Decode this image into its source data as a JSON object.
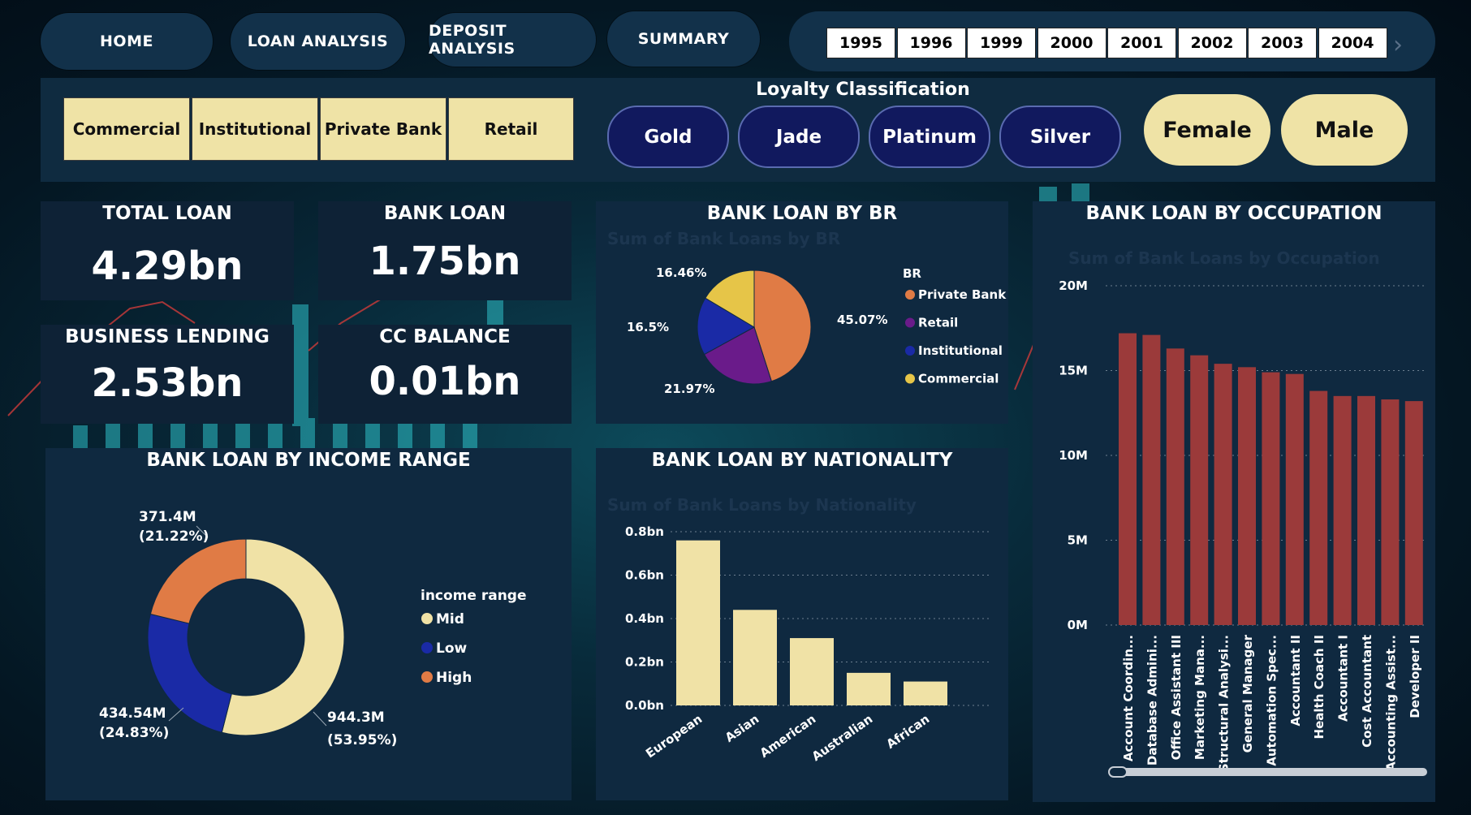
{
  "nav": {
    "home": "HOME",
    "loan_analysis": "LOAN ANALYSIS",
    "deposit_analysis": "DEPOSIT ANALYSIS",
    "summary": "SUMMARY"
  },
  "years": [
    "1995",
    "1996",
    "1999",
    "2000",
    "2001",
    "2002",
    "2003",
    "2004"
  ],
  "filters": {
    "segments": [
      "Commercial",
      "Institutional",
      "Private Bank",
      "Retail"
    ],
    "loyalty_title": "Loyalty Classification",
    "loyalty": [
      "Gold",
      "Jade",
      "Platinum",
      "Silver"
    ],
    "gender": [
      "Female",
      "Male"
    ]
  },
  "kpis": {
    "total_loan": {
      "label": "TOTAL LOAN",
      "value": "4.29bn"
    },
    "bank_loan": {
      "label": "BANK LOAN",
      "value": "1.75bn"
    },
    "business_lending": {
      "label": "BUSINESS LENDING",
      "value": "2.53bn"
    },
    "cc_balance": {
      "label": "CC BALANCE",
      "value": "0.01bn"
    }
  },
  "colors": {
    "orange": "#e07b45",
    "purple": "#6a1b8a",
    "blue": "#1a2aa6",
    "yellow": "#e6c548",
    "cream": "#f0e2a6",
    "maroon": "#9b3a3a",
    "panel": "#0f2940"
  },
  "chart_data": [
    {
      "type": "pie",
      "title": "BANK LOAN BY BR",
      "subtitle": "Sum of Bank Loans by BR",
      "legend_title": "BR",
      "legend_position": "right",
      "categories": [
        "Private Bank",
        "Retail",
        "Institutional",
        "Commercial"
      ],
      "values": [
        45.07,
        21.97,
        16.5,
        16.46
      ],
      "labels": [
        "45.07%",
        "21.97%",
        "16.5%",
        "16.46%"
      ],
      "colors": [
        "#e07b45",
        "#6a1b8a",
        "#1a2aa6",
        "#e6c548"
      ]
    },
    {
      "type": "pie",
      "title": "BANK LOAN BY INCOME RANGE",
      "legend_title": "income range",
      "legend_position": "right",
      "categories": [
        "Mid",
        "Low",
        "High"
      ],
      "values": [
        944.3,
        434.54,
        371.4
      ],
      "labels": [
        "944.3M",
        "434.54M",
        "371.4M"
      ],
      "percent_labels": [
        "(53.95%)",
        "(24.83%)",
        "(21.22%)"
      ],
      "colors": [
        "#f0e2a6",
        "#1a2aa6",
        "#e07b45"
      ]
    },
    {
      "type": "bar",
      "title": "BANK LOAN BY NATIONALITY",
      "subtitle": "Sum of Bank Loans by Nationality",
      "categories": [
        "European",
        "Asian",
        "American",
        "Australian",
        "African"
      ],
      "values": [
        0.76,
        0.44,
        0.31,
        0.15,
        0.11
      ],
      "ylim": [
        0,
        0.8
      ],
      "yticks": [
        0,
        0.2,
        0.4,
        0.6,
        0.8
      ],
      "ytick_labels": [
        "0.0bn",
        "0.2bn",
        "0.4bn",
        "0.6bn",
        "0.8bn"
      ],
      "grid": true,
      "color": "#f0e2a6"
    },
    {
      "type": "bar",
      "title": "BANK LOAN BY OCCUPATION",
      "subtitle": "Sum of Bank Loans by Occupation",
      "categories": [
        "Account Coordin...",
        "Database Admini...",
        "Office Assistant III",
        "Marketing Mana...",
        "Structural Analysi...",
        "General Manager",
        "Automation Spec...",
        "Accountant II",
        "Health Coach II",
        "Accountant I",
        "Cost Accountant",
        "Accounting Assist...",
        "Developer II"
      ],
      "values": [
        17.2,
        17.1,
        16.3,
        15.9,
        15.4,
        15.2,
        14.9,
        14.8,
        13.8,
        13.5,
        13.5,
        13.3,
        13.2
      ],
      "ylim": [
        0,
        20
      ],
      "yticks": [
        0,
        5,
        10,
        15,
        20
      ],
      "ytick_labels": [
        "0M",
        "5M",
        "10M",
        "15M",
        "20M"
      ],
      "grid": true,
      "color": "#9b3a3a"
    }
  ]
}
